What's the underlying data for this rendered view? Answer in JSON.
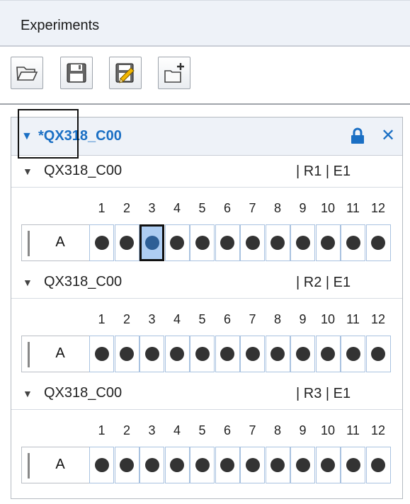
{
  "header": {
    "title": "Experiments"
  },
  "toolbar": {
    "buttons": [
      {
        "name": "open-folder",
        "icon": "folder-open-icon"
      },
      {
        "name": "save",
        "icon": "floppy-disk-icon"
      },
      {
        "name": "edit",
        "icon": "edit-pencil-icon"
      },
      {
        "name": "new",
        "icon": "new-folder-plus-icon"
      }
    ]
  },
  "experiment": {
    "title": "*QX318_C00",
    "locked": true,
    "accent_color": "#1a6fc4"
  },
  "columns": [
    "1",
    "2",
    "3",
    "4",
    "5",
    "6",
    "7",
    "8",
    "9",
    "10",
    "11",
    "12"
  ],
  "plates": [
    {
      "name": "QX318_C00",
      "tag": "| R1 | E1",
      "row": "A",
      "selected_well": 3
    },
    {
      "name": "QX318_C00",
      "tag": "| R2 | E1",
      "row": "A",
      "selected_well": null
    },
    {
      "name": "QX318_C00",
      "tag": "| R3 | E1",
      "row": "A",
      "selected_well": null
    }
  ]
}
